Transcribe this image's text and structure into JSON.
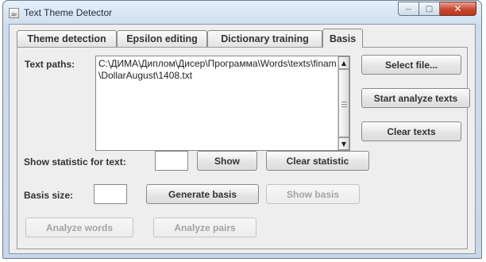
{
  "window": {
    "title": "Text Theme Detector",
    "app_icon": "java-icon",
    "controls": {
      "minimize": "—",
      "maximize": "□",
      "close": "✕"
    }
  },
  "tabs": [
    {
      "label": "Theme detection",
      "active": false
    },
    {
      "label": "Epsilon editing",
      "active": false
    },
    {
      "label": "Dictionary training",
      "active": false
    },
    {
      "label": "Basis",
      "active": true
    }
  ],
  "basis": {
    "text_paths_label": "Text paths:",
    "text_paths_value": "C:\\ДИМА\\Диплом\\Дисер\\Программа\\Words\\texts\\finam\\DollarAugust\\1408.txt",
    "select_file": "Select file...",
    "start_analyze": "Start analyze texts",
    "clear_texts": "Clear texts",
    "show_statistic_label": "Show statistic for text:",
    "show_statistic_value": "",
    "show": "Show",
    "clear_statistic": "Clear statistic",
    "basis_size_label": "Basis size:",
    "basis_size_value": "",
    "generate_basis": "Generate basis",
    "show_basis": "Show basis",
    "analyze_words": "Analyze words",
    "analyze_pairs": "Analyze pairs"
  },
  "scroll": {
    "up": "▲",
    "down": "▼"
  }
}
